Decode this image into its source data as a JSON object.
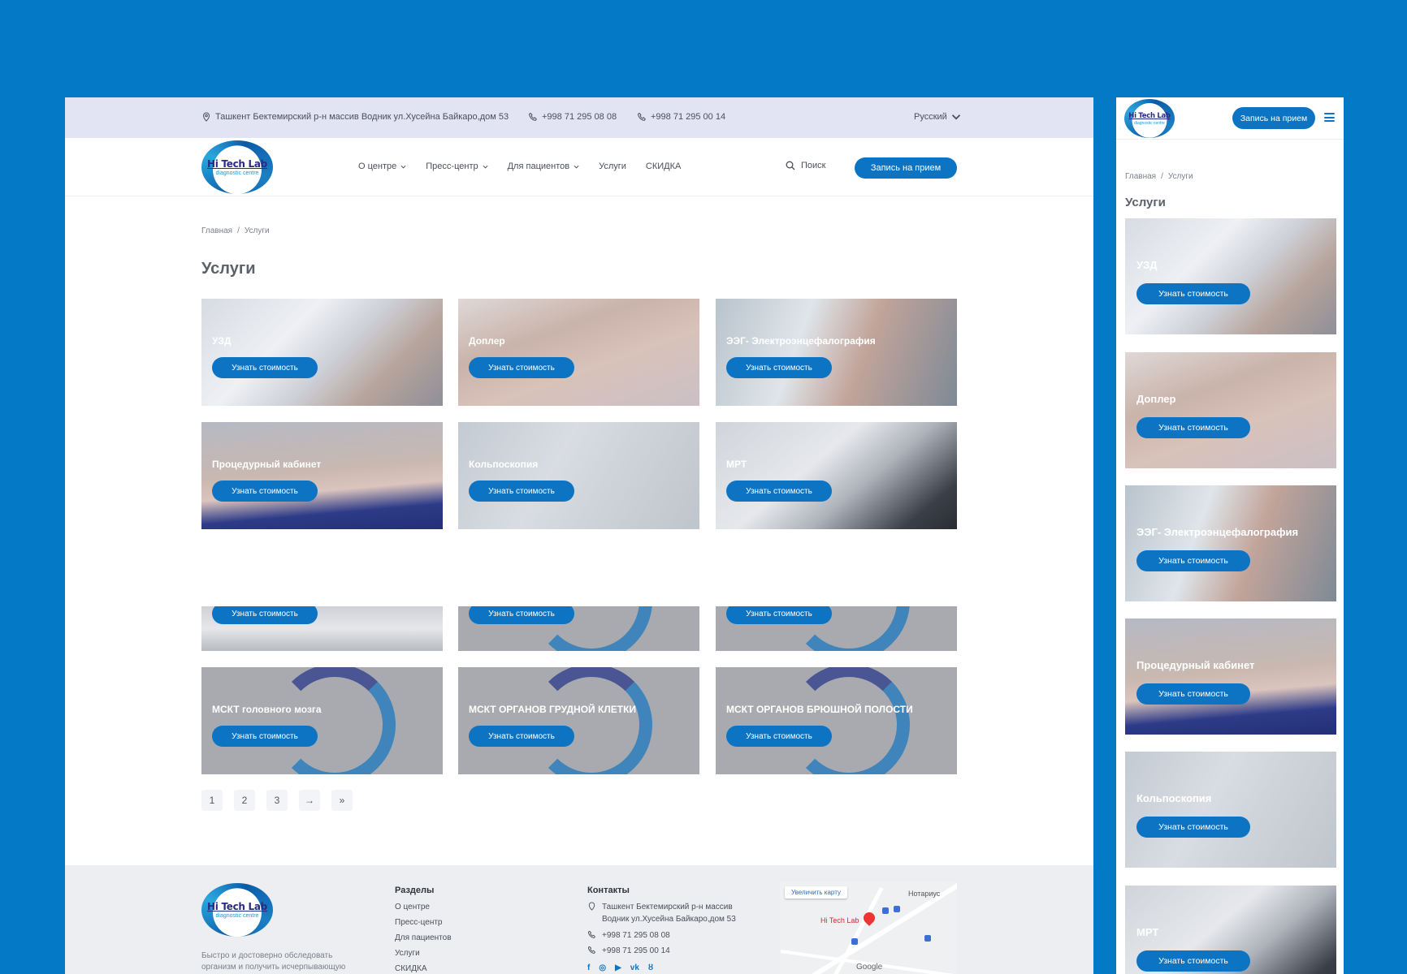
{
  "topbar": {
    "address": "Ташкент Бектемирский р-н массив Водник ул.Хусейна Байкаро,дом 53",
    "phone1": "+998 71 295 08 08",
    "phone2": "+998 71 295 00 14",
    "language": "Русский"
  },
  "logo": {
    "line1": "Hi Tech Lab",
    "line2": "diagnostic centre"
  },
  "nav": {
    "items": [
      "О центре",
      "Пресс-центр",
      "Для пациентов",
      "Услуги",
      "СКИДКА"
    ],
    "search_label": "Поиск",
    "book_label": "Запись на прием"
  },
  "breadcrumb": {
    "home": "Главная",
    "sep": "/",
    "current": "Услуги"
  },
  "page_title": "Услуги",
  "card_button": "Узнать стоимость",
  "cards": [
    {
      "title": "УЗД"
    },
    {
      "title": "Доплер"
    },
    {
      "title": "ЭЭГ- Электроэнцефалография"
    },
    {
      "title": "Процедурный кабинет"
    },
    {
      "title": "Кольпоскопия"
    },
    {
      "title": "МРТ"
    },
    {
      "title": "МСКТ головного мозга"
    },
    {
      "title": "МСКТ ОРГАНОВ ГРУДНОЙ КЛЕТКИ"
    },
    {
      "title": "МСКТ ОРГАНОВ БРЮШНОЙ ПОЛОСТИ"
    }
  ],
  "pagination": [
    "1",
    "2",
    "3",
    "→",
    "»"
  ],
  "footer": {
    "tagline_1": "Быстро и достоверно обследовать",
    "tagline_2": "организм и получить исчерпывающую",
    "sections_title": "Разделы",
    "sections": [
      "О центре",
      "Пресс-центр",
      "Для пациентов",
      "Услуги",
      "СКИДКА"
    ],
    "contacts_title": "Контакты",
    "address_1": "Ташкент Бектемирский р-н массив",
    "address_2": "Водник ул.Хусейна Байкаро,дом 53",
    "phone1": "+998 71 295 08 08",
    "phone2": "+998 71 295 00 14",
    "map": {
      "enlarge": "Увеличить карту",
      "place": "Hi Tech Lab",
      "poi": "Нотариус",
      "brand": "Google"
    }
  },
  "mobile": {
    "book_label": "Запись на прием",
    "breadcrumb_home": "Главная",
    "breadcrumb_current": "Услуги",
    "title": "Услуги",
    "cards": [
      "УЗД",
      "Доплер",
      "ЭЭГ- Электроэнцефалография",
      "Процедурный кабинет",
      "Кольпоскопия",
      "МРТ"
    ]
  },
  "colors": {
    "background": "#0479c6",
    "accent": "#0d74c4",
    "topbar": "#e3e4f3",
    "footer": "#eceef2"
  }
}
